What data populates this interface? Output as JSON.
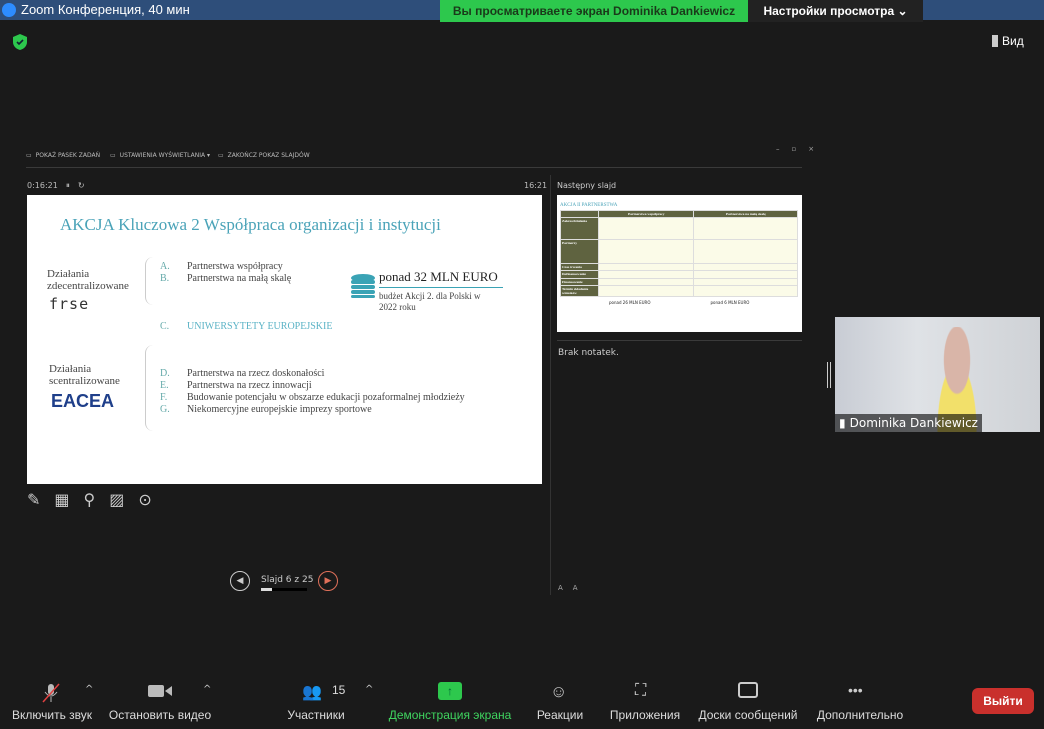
{
  "window": {
    "title": "Zoom Конференция, 40 мин",
    "banner": "Вы просматриваете экран Dominika Dankiewicz",
    "view_settings": "Настройки просмотра",
    "view_button": "Вид"
  },
  "ppt": {
    "toolbar": [
      "POKAŻ PASEK ZADAŃ",
      "USTAWIENIA WYŚWIETLANIA ▾",
      "ZAKOŃCZ POKAZ SLAJDÓW"
    ],
    "elapsed": "0:16:21",
    "clock": "16:21",
    "slide_counter": "Slajd 6 z 25",
    "slide_progress": 0.24,
    "next_slide_label": "Następny slajd",
    "notes": "Brak notatek.",
    "font_controls": [
      "A",
      "A"
    ]
  },
  "slide": {
    "title": "AKCJA Kluczowa 2  Współpraca organizacji i instytucji",
    "group1": "Działania zdecentralizowane",
    "logo1": "frse",
    "group2": "Działania scentralizowane",
    "logo2": "EACEA",
    "items": [
      {
        "l": "A.",
        "t": "Partnerstwa współpracy"
      },
      {
        "l": "B.",
        "t": "Partnerstwa na małą skalę"
      },
      {
        "l": "C.",
        "t": "UNIWERSYTETY EUROPEJSKIE"
      },
      {
        "l": "D.",
        "t": "Partnerstwa na rzecz doskonałości"
      },
      {
        "l": "E.",
        "t": "Partnerstwa na rzecz innowacji"
      },
      {
        "l": "F.",
        "t": "Budowanie potencjału w obszarze edukacji pozaformalnej młodzieży"
      },
      {
        "l": "G.",
        "t": "Niekomercyjne europejskie imprezy sportowe"
      }
    ],
    "budget": "ponad 32 MLN EURO",
    "budget_sub": "budżet Akcji 2. dla Polski w 2022 roku"
  },
  "next_slide": {
    "title": "AKCJA II PARTNERSTWA",
    "cols": [
      "Partnerstwa współpracy",
      "Partnerstwa na małą skalę"
    ],
    "rows": [
      "Zakres/działania",
      "Partnerzy",
      "Czas trwania",
      "Dofinansowanie",
      "Finansowanie",
      "Termin składania wniosków"
    ],
    "b1": "ponad 26 MLN EURO",
    "b2": "ponad 6 MLN EURO"
  },
  "participant": {
    "name": "Dominika Dankiewicz"
  },
  "toolbar": {
    "mute": "Включить звук",
    "video": "Остановить видео",
    "participants": "Участники",
    "participants_count": "15",
    "share": "Демонстрация экрана",
    "reactions": "Реакции",
    "apps": "Приложения",
    "whiteboards": "Доски сообщений",
    "more": "Дополнительно",
    "leave": "Выйти"
  },
  "colors": {
    "share_green": "#2dc84d",
    "leave_red": "#c9302c",
    "slide_accent": "#4aa3b8"
  }
}
